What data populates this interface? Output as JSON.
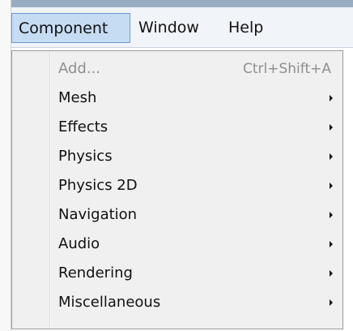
{
  "menubar": {
    "items": [
      {
        "label": "Component",
        "active": true
      },
      {
        "label": "Window"
      },
      {
        "label": "Help"
      }
    ]
  },
  "menu": {
    "items": [
      {
        "label": "Add...",
        "shortcut": "Ctrl+Shift+A",
        "disabled": true
      },
      {
        "label": "Mesh",
        "submenu": true
      },
      {
        "label": "Effects",
        "submenu": true
      },
      {
        "label": "Physics",
        "submenu": true
      },
      {
        "label": "Physics 2D",
        "submenu": true
      },
      {
        "label": "Navigation",
        "submenu": true
      },
      {
        "label": "Audio",
        "submenu": true
      },
      {
        "label": "Rendering",
        "submenu": true
      },
      {
        "label": "Miscellaneous",
        "submenu": true
      }
    ]
  },
  "colors": {
    "menubar_highlight": "#c6dcf3",
    "menubar_highlight_border": "#6a9bd0",
    "menu_background": "#f0f0f0",
    "disabled_text": "#8f8f8f"
  },
  "icons": {
    "submenu": "chevron-right-icon"
  }
}
